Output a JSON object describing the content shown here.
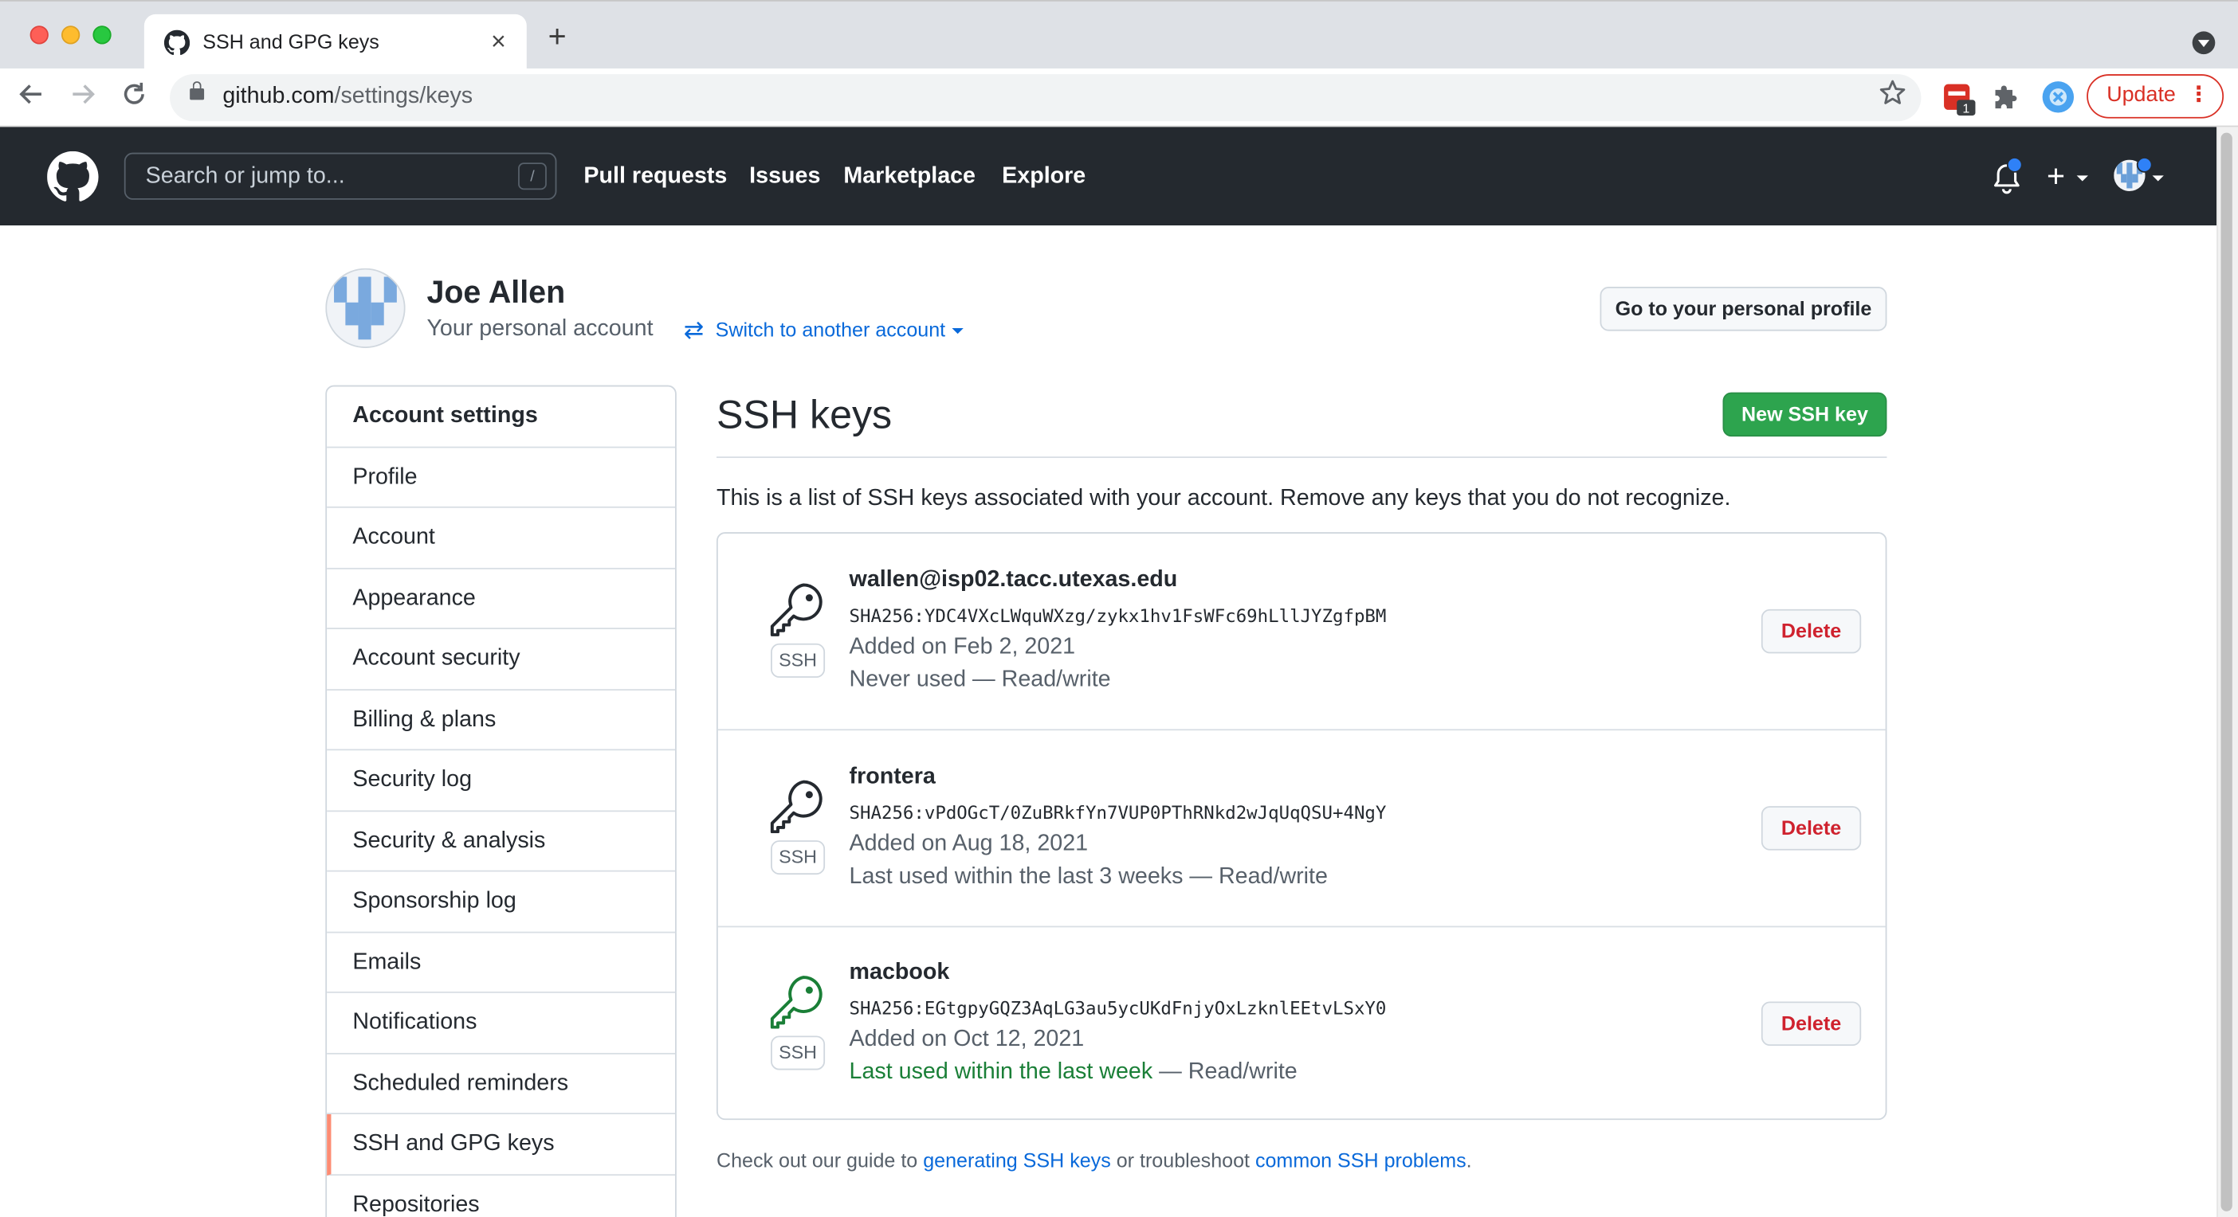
{
  "browser": {
    "tab_title": "SSH and GPG keys",
    "tab_close": "×",
    "new_tab": "+",
    "url_host": "github.com",
    "url_path": "/settings/keys",
    "extension_badge": "1",
    "update_label": "Update",
    "update_menu": "⋮",
    "icons": [
      "github-favicon",
      "back-arrow",
      "forward-arrow",
      "reload",
      "lock",
      "star",
      "extension",
      "puzzle",
      "profile",
      "menu"
    ]
  },
  "header": {
    "search_placeholder": "Search or jump to...",
    "search_shortcut": "/",
    "nav": [
      "Pull requests",
      "Issues",
      "Marketplace",
      "Explore"
    ],
    "plus": "+"
  },
  "profile": {
    "name": "Joe Allen",
    "subtitle": "Your personal account",
    "switch_label": "Switch to another account",
    "profile_button": "Go to your personal profile"
  },
  "sidebar": {
    "heading": "Account settings",
    "items": [
      {
        "label": "Profile"
      },
      {
        "label": "Account"
      },
      {
        "label": "Appearance"
      },
      {
        "label": "Account security"
      },
      {
        "label": "Billing & plans"
      },
      {
        "label": "Security log"
      },
      {
        "label": "Security & analysis"
      },
      {
        "label": "Sponsorship log"
      },
      {
        "label": "Emails"
      },
      {
        "label": "Notifications"
      },
      {
        "label": "Scheduled reminders"
      },
      {
        "label": "SSH and GPG keys",
        "active": true
      },
      {
        "label": "Repositories"
      }
    ]
  },
  "main": {
    "title": "SSH keys",
    "new_button": "New SSH key",
    "intro": "This is a list of SSH keys associated with your account. Remove any keys that you do not recognize.",
    "badge": "SSH",
    "delete_label": "Delete",
    "keys": [
      {
        "title": "wallen@isp02.tacc.utexas.edu",
        "fingerprint": "SHA256:YDC4VXcLWquWXzg/zykx1hv1FsWFc69hLllJYZgfpBM",
        "added": "Added on Feb 2, 2021",
        "usage": "Never used",
        "access": " — Read/write",
        "recent": false
      },
      {
        "title": "frontera",
        "fingerprint": "SHA256:vPdOGcT/0ZuBRkfYn7VUP0PThRNkd2wJqUqQSU+4NgY",
        "added": "Added on Aug 18, 2021",
        "usage": "Last used within the last 3 weeks",
        "access": " — Read/write",
        "recent": false
      },
      {
        "title": "macbook",
        "fingerprint": "SHA256:EGtgpyGQZ3AqLG3au5ycUKdFnjyOxLzknlEEtvLSxY0",
        "added": "Added on Oct 12, 2021",
        "usage": "Last used within the last week",
        "access": " — Read/write",
        "recent": true
      }
    ],
    "footer": {
      "prefix": "Check out our guide to ",
      "link1": "generating SSH keys",
      "middle": " or troubleshoot ",
      "link2": "common SSH problems",
      "suffix": "."
    }
  },
  "colors": {
    "header_bg": "#24292f",
    "primary_button": "#2da44e",
    "danger": "#cf222e",
    "link": "#0969da",
    "recent_usage": "#1a7f37",
    "active_marker": "#fd8c73"
  }
}
